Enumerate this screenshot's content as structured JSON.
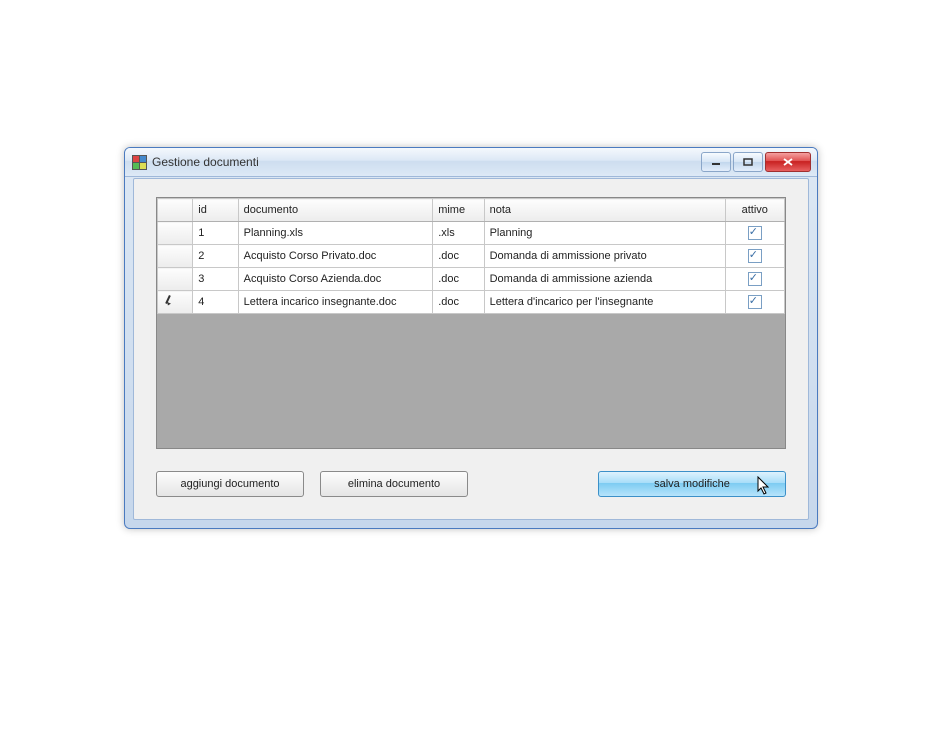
{
  "window": {
    "title": "Gestione documenti"
  },
  "grid": {
    "headers": {
      "id": "id",
      "documento": "documento",
      "mime": "mime",
      "nota": "nota",
      "attivo": "attivo"
    },
    "rows": [
      {
        "indicator": "",
        "id": "1",
        "documento": "Planning.xls",
        "mime": ".xls",
        "nota": "Planning",
        "attivo": true
      },
      {
        "indicator": "",
        "id": "2",
        "documento": "Acquisto Corso Privato.doc",
        "mime": ".doc",
        "nota": "Domanda di ammissione privato",
        "attivo": true
      },
      {
        "indicator": "",
        "id": "3",
        "documento": "Acquisto Corso Azienda.doc",
        "mime": ".doc",
        "nota": "Domanda di ammissione azienda",
        "attivo": true
      },
      {
        "indicator": "edit",
        "id": "4",
        "documento": "Lettera incarico insegnante.doc",
        "mime": ".doc",
        "nota": "Lettera d'incarico per l'insegnante",
        "attivo": true
      }
    ]
  },
  "buttons": {
    "add": "aggiungi documento",
    "delete": "elimina documento",
    "save": "salva modifiche"
  }
}
